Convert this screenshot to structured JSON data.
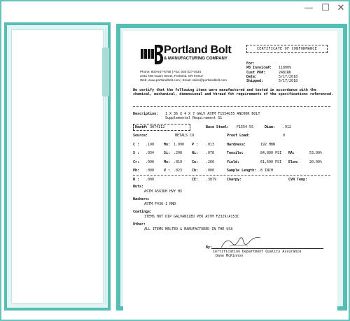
{
  "window": {
    "minimize_icon": "—",
    "maximize_icon": "☐",
    "close_icon": "✕"
  },
  "company": {
    "name": "Portland Bolt",
    "subtitle": "& MANUFACTURING COMPANY",
    "contact": [
      "Phone: 800-547-6758 | Fax: 503-227-4634",
      "3441 NW Guam Street, Portland, OR 97210",
      "Web: www.portlandbolt.com | Email: sales@portlandbolt.com"
    ]
  },
  "certificate": {
    "title": "CERTIFICATE OF CONFORMANCE",
    "refs": [
      {
        "label": "For:",
        "value": ""
      },
      {
        "label": "PB Invoice#:",
        "value": "118009"
      },
      {
        "label": "Cust PO#:",
        "value": "2481RK"
      },
      {
        "label": "Date:",
        "value": "5/17/2018"
      },
      {
        "label": "Shipped:",
        "value": "5/17/2018"
      }
    ],
    "statement": "We certify that the following items were manufactured and tested in accordance with the chemical, mechanical, dimensional and thread fit requirements of the specifications referenced.",
    "description_label": "Description:",
    "description_line1": "1 X 36 X 4 X 7 GALV ASTM F1554G55 ANCHOR BOLT",
    "description_line2": "Supplemental Requirement S1",
    "heat_label": "Heat#:",
    "heat_value": "3074112",
    "base_steel_label": "Base Steel:",
    "base_steel_value": "F1554-55",
    "diam_label": "Diam:",
    "diam_value": ".912"
  },
  "properties": [
    {
      "label": "Source:",
      "value": "METALS CO",
      "label2": "Proof Load:",
      "value2": "0"
    },
    {
      "label": "C :",
      "value": ".190",
      "label_b": "Mn:",
      "value_b": "1.090",
      "label_c": "P :",
      "value_c": ".013",
      "label2": "Hardness:",
      "value2": "192 HBN"
    },
    {
      "label": "S :",
      "value": ".034",
      "label_b": "Si:",
      "value_b": ".200",
      "label_c": "Ni:",
      "value_c": ".070",
      "label2": "Tensile:",
      "value2": "84,800 PSI",
      "label3": "RA:",
      "value3": "53.00%"
    },
    {
      "label": "Cr:",
      "value": ".090",
      "label_b": "Mo:",
      "value_b": ".019",
      "label_c": "Cu:",
      "value_c": ".260",
      "label2": "Yield:",
      "value2": "61,600 PSI",
      "label3": "Elon:",
      "value3": "20.00%"
    },
    {
      "label": "Pb:",
      "value": ".000",
      "label_b": "V :",
      "value_b": ".023",
      "label_c": "Cb:",
      "value_c": ".000",
      "label2": "Sample Length:",
      "value2": "8 INCH"
    },
    {
      "label": "N :",
      "value": ".000",
      "label_b": "",
      "value_b": "",
      "label_c": "CE:",
      "value_c": ".3879",
      "label2": "Charpy:",
      "value2": "",
      "label3": "CVN Temp:",
      "value3": ""
    }
  ],
  "notes": [
    {
      "title": "Nuts:",
      "text": "ASTM A563DH HVY HX"
    },
    {
      "title": "Washers:",
      "text": "ASTM F436-1 RND"
    },
    {
      "title": "Coatings:",
      "text": "ITEMS HOT DIP GALVANIZED PER ASTM F2329/A153C"
    },
    {
      "title": "Other:",
      "text": "ALL ITEMS MELTED & MANUFACTURED IN THE USA"
    }
  ],
  "signature": {
    "by": "By:",
    "title": "Certification Department Quality Assurance",
    "name": "Dane McKinnon"
  },
  "colors": {
    "frame": "#55bdb3",
    "window_border": "#62c4bb",
    "panel_bg": "#e3f5f2"
  }
}
